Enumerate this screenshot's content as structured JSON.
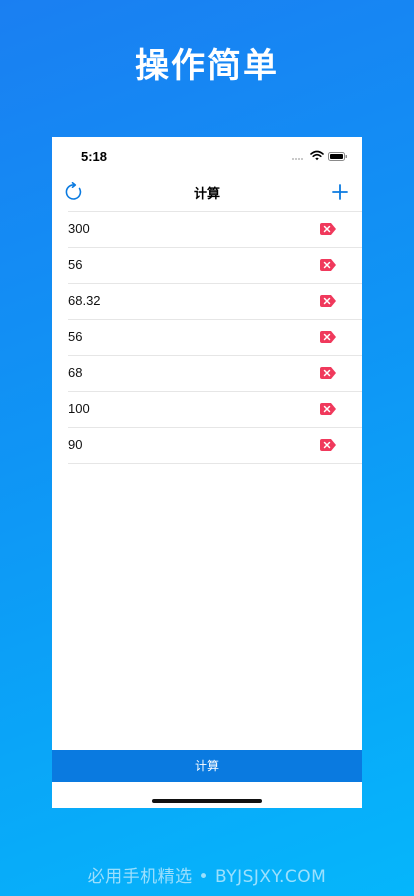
{
  "promo": {
    "title": "操作简单"
  },
  "status_bar": {
    "time": "5:18"
  },
  "nav": {
    "title": "计算",
    "refresh_icon": "refresh-icon",
    "add_icon": "plus-icon"
  },
  "list": {
    "items": [
      {
        "value": "300"
      },
      {
        "value": "56"
      },
      {
        "value": "68.32"
      },
      {
        "value": "56"
      },
      {
        "value": "68"
      },
      {
        "value": "100"
      },
      {
        "value": "90"
      }
    ],
    "delete_icon": "delete-tag-icon"
  },
  "bottom": {
    "calc_label": "计算"
  },
  "footer": {
    "text": "必用手机精选 • BYJSJXY.COM"
  },
  "colors": {
    "accent": "#0a7ae0",
    "delete": "#f0395c",
    "background_top": "#1a7ff2",
    "background_bottom": "#05b6fb"
  }
}
